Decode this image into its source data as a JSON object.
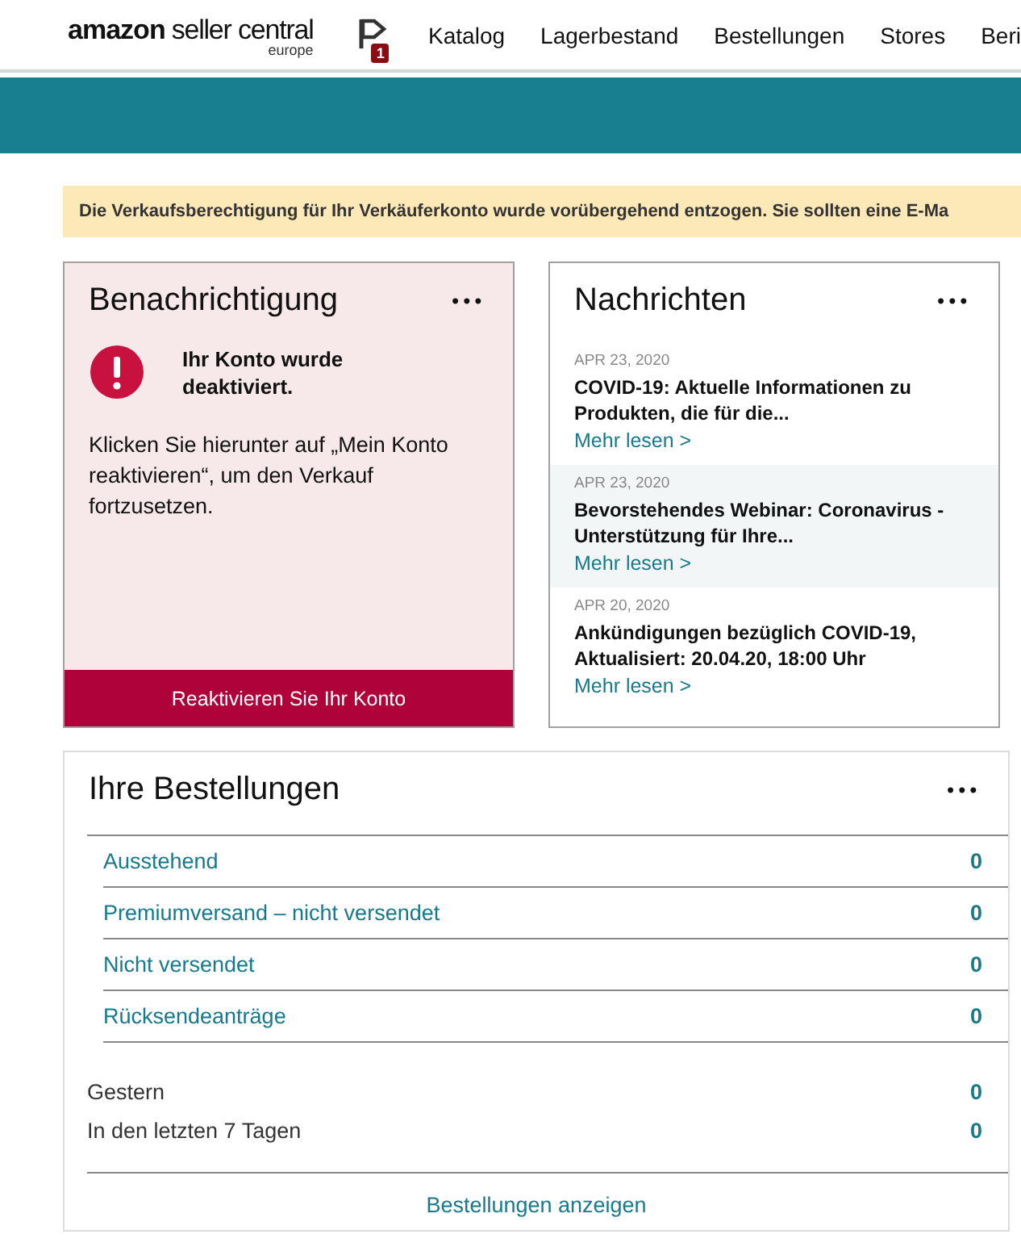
{
  "header": {
    "logo": {
      "brand": "amazon",
      "product": "seller central",
      "region": "europe"
    },
    "notifications": {
      "badge": "1"
    },
    "nav": [
      "Katalog",
      "Lagerbestand",
      "Bestellungen",
      "Stores",
      "Beri"
    ]
  },
  "banner": "Die Verkaufsberechtigung für Ihr Verkäuferkonto wurde vorübergehend entzogen. Sie sollten eine E-Ma",
  "alert_card": {
    "title": "Benachrichtigung",
    "menu": "•••",
    "headline": "Ihr Konto wurde deaktiviert.",
    "body": "Klicken Sie hierunter auf „Mein Konto reaktivieren“, um den Verkauf fortzusetzen.",
    "button": "Reaktivieren Sie Ihr Konto"
  },
  "news_card": {
    "title": "Nachrichten",
    "menu": "•••",
    "items": [
      {
        "date": "APR 23, 2020",
        "headline": "COVID-19: Aktuelle Informationen zu Produkten, die für die...",
        "link": "Mehr lesen >",
        "selected": false
      },
      {
        "date": "APR 23, 2020",
        "headline": "Bevorstehendes Webinar: Coronavirus - Unterstützung für Ihre...",
        "link": "Mehr lesen >",
        "selected": true
      },
      {
        "date": "APR 20, 2020",
        "headline": "Ankündigungen bezüglich COVID-19, Aktualisiert: 20.04.20, 18:00 Uhr",
        "link": "Mehr lesen >",
        "selected": false
      }
    ]
  },
  "orders_card": {
    "title": "Ihre Bestellungen",
    "menu": "•••",
    "links": [
      {
        "label": "Ausstehend",
        "count": "0"
      },
      {
        "label": "Premiumversand – nicht versendet",
        "count": "0"
      },
      {
        "label": "Nicht versendet",
        "count": "0"
      },
      {
        "label": "Rücksendeanträge",
        "count": "0"
      }
    ],
    "stats": [
      {
        "label": "Gestern",
        "count": "0"
      },
      {
        "label": "In den letzten 7 Tagen",
        "count": "0"
      }
    ],
    "footer_link": "Bestellungen anzeigen"
  }
}
